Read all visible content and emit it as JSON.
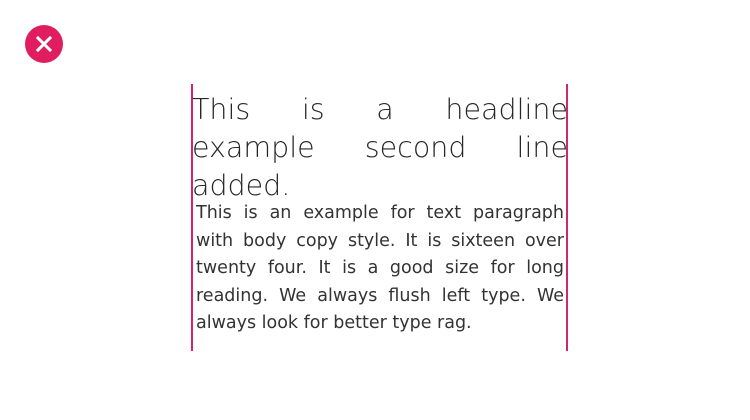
{
  "status_icon": {
    "icon": "close-icon",
    "color": "#e01d5f",
    "glyph_color": "#ffffff"
  },
  "guides": {
    "color": "#d02670"
  },
  "headline": {
    "text": "This is a headline example second line added."
  },
  "paragraph": {
    "text": "This is an example for text paragraph with body copy style. It is sixteen over twenty four. It is a good size for long reading. We always flush left type. We always look for better type rag."
  }
}
